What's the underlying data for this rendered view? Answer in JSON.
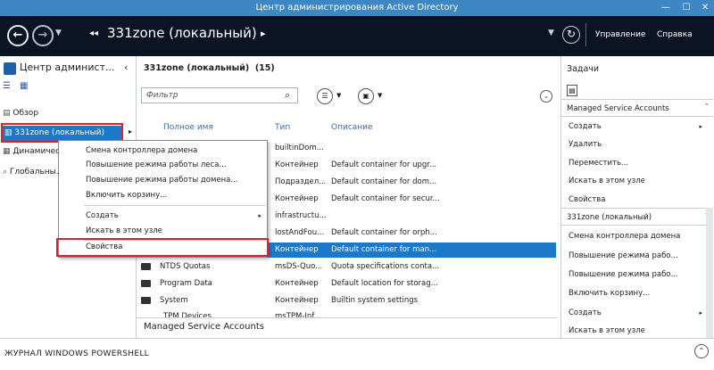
{
  "window": {
    "title": "Центр администрирования Active Directory",
    "min": "—",
    "max": "☐",
    "close": "✕"
  },
  "toolbar": {
    "breadcrumb_arrows": "◂◂",
    "breadcrumb": "331zone (локальный)",
    "breadcrumb_chev": "▸",
    "manage": "Управление",
    "help": "Справка"
  },
  "left": {
    "title": "Центр админист...",
    "items": [
      "Обзор",
      "331zone (локальный)",
      "Динамичес...",
      "Глобальны..."
    ]
  },
  "main": {
    "title": "331zone (локальный)",
    "count": "(15)",
    "filter_placeholder": "Фильтр",
    "columns": [
      "Полное имя",
      "Тип",
      "Описание"
    ],
    "rows": [
      {
        "name": "",
        "type": "builtinDom...",
        "desc": ""
      },
      {
        "name": "",
        "type": "Контейнер",
        "desc": "Default container for upgr..."
      },
      {
        "name": "",
        "type": "Подраздел...",
        "desc": "Default container for dom..."
      },
      {
        "name": "",
        "type": "Контейнер",
        "desc": "Default container for secur..."
      },
      {
        "name": "",
        "type": "infrastructu...",
        "desc": ""
      },
      {
        "name": "",
        "type": "lostAndFou...",
        "desc": "Default container for orph..."
      },
      {
        "name": "",
        "type": "Контейнер",
        "desc": "Default container for man..."
      },
      {
        "name": "NTDS Quotas",
        "type": "msDS-Quo...",
        "desc": "Quota specifications conta..."
      },
      {
        "name": "Program Data",
        "type": "Контейнер",
        "desc": "Default location for storag..."
      },
      {
        "name": "System",
        "type": "Контейнер",
        "desc": "Builtin system settings"
      },
      {
        "name": "TPM Devices",
        "type": "msTPM-Inf...",
        "desc": ""
      }
    ],
    "detail": "Managed Service Accounts"
  },
  "context": {
    "items": [
      "Смена контроллера домена",
      "Повышение режима работы леса...",
      "Повышение режима работы домена...",
      "Включить корзину...",
      "Создать",
      "Искать в этом узле",
      "Свойства"
    ]
  },
  "tasks": {
    "title": "Задачи",
    "section1": "Managed Service Accounts",
    "items1": [
      "Создать",
      "Удалить",
      "Переместить...",
      "Искать в этом узле",
      "Свойства"
    ],
    "section2": "331zone (локальный)",
    "items2": [
      "Смена контроллера домена",
      "Повышение режима рабо...",
      "Повышение режима рабо...",
      "Включить корзину...",
      "Создать",
      "Искать в этом узле"
    ]
  },
  "powershell": {
    "label": "ЖУРНАЛ WINDOWS POWERSHELL"
  },
  "colors": {
    "accent": "#0a6fc2",
    "selected": "#1c78c8",
    "highlight_box": "#e0202a"
  }
}
